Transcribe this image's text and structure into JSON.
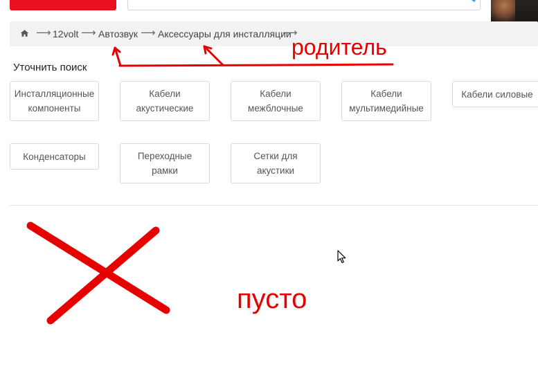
{
  "breadcrumb": {
    "separator": "⟶",
    "items": [
      {
        "label": "12volt"
      },
      {
        "label": "Автозвук"
      },
      {
        "label": "Аксессуары для инсталляции"
      }
    ]
  },
  "refine": {
    "title": "Уточнить поиск",
    "chips": [
      {
        "label": "Инсталляционные компоненты"
      },
      {
        "label": "Кабели акустические"
      },
      {
        "label": "Кабели межблочные"
      },
      {
        "label": "Кабели мультимедийные"
      },
      {
        "label": "Кабели силовые"
      },
      {
        "label": "Конденсаторы"
      },
      {
        "label": "Переходные рамки"
      },
      {
        "label": "Сетки для акустики"
      }
    ]
  },
  "annotations": {
    "parent_note": "родитель",
    "empty_note": "пусто",
    "color": "#e60000"
  },
  "colors": {
    "accent_red": "#e8121f",
    "search_icon_blue": "#37a2d8",
    "breadcrumb_bg": "#f2f2f2"
  },
  "icons": {
    "home": "home-icon",
    "search": "search-icon",
    "cursor": "cursor-icon"
  }
}
